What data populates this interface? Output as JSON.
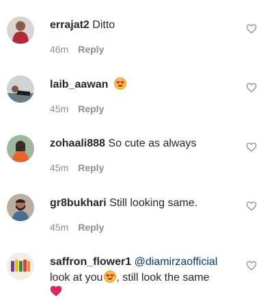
{
  "comments": [
    {
      "username": "errajat2",
      "text": "Ditto",
      "time": "46m",
      "reply_label": "Reply",
      "avatar": "avatar-man-red-shirt"
    },
    {
      "username": "laib_aawan",
      "text": "",
      "emoji": "heart-eyes-emoji",
      "time": "45m",
      "reply_label": "Reply",
      "avatar": "avatar-person-lying"
    },
    {
      "username": "zohaali888",
      "text": "So cute as always",
      "time": "45m",
      "reply_label": "Reply",
      "avatar": "avatar-woman-orange"
    },
    {
      "username": "gr8bukhari",
      "text": "Still looking same.",
      "time": "45m",
      "reply_label": "Reply",
      "avatar": "avatar-man-beard"
    },
    {
      "username": "saffron_flower1",
      "mention": "@diamirzaofficial",
      "text_line2_a": "look at you",
      "text_line2_b": ", still look the same",
      "emoji": "heart-eyes-emoji",
      "end_emoji": "red-heart-emoji",
      "avatar": "avatar-colorful-items"
    }
  ],
  "icons": {
    "like": "heart-outline-icon"
  },
  "colors": {
    "username": "#262626",
    "meta": "#8e8e8e",
    "mention": "#00376b",
    "heart": "#e0245e",
    "emoji_face": "#f7c23c"
  }
}
